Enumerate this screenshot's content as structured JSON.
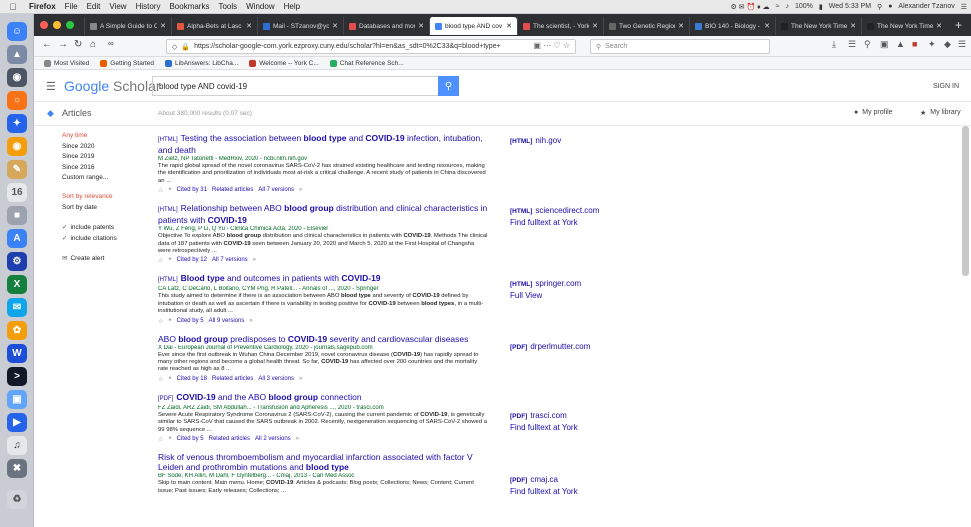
{
  "menubar": {
    "apple": "",
    "items": [
      "Firefox",
      "File",
      "Edit",
      "View",
      "History",
      "Bookmarks",
      "Tools",
      "Window",
      "Help"
    ],
    "battery": "100%",
    "clock": "Wed 5:33 PM",
    "user": "Alexander Tzanov"
  },
  "tabs": [
    {
      "label": "A Simple Guide to C",
      "color": "#888888"
    },
    {
      "label": "Alpha-Bets at Lasc",
      "color": "#e0573b"
    },
    {
      "label": "Mail - STzanov@yo",
      "color": "#2c6fd1"
    },
    {
      "label": "Databases and mor",
      "color": "#e34d4d"
    },
    {
      "label": "blood type AND cov",
      "color": "#4285f4"
    },
    {
      "label": "The scientist, - York",
      "color": "#e34d4d"
    },
    {
      "label": "Two Genetic Region",
      "color": "#444444"
    },
    {
      "label": "BIO 140 - Biology -",
      "color": "#3a7bd5"
    },
    {
      "label": "The New York Time",
      "color": "#222222"
    },
    {
      "label": "The New York Time",
      "color": "#222222"
    }
  ],
  "nav": {
    "url": "https://scholar-google-com.york.ezproxy.cuny.edu/scholar?hl=en&as_sdt=0%2C33&q=blood+type+",
    "search_placeholder": "Search"
  },
  "bookmarks": [
    {
      "label": "Most Visited",
      "color": "#888888"
    },
    {
      "label": "Getting Started",
      "color": "#e66000"
    },
    {
      "label": "LibAnswers: LibCha...",
      "color": "#2c6fd1"
    },
    {
      "label": "Welcome -- York C...",
      "color": "#c0392b"
    },
    {
      "label": "Chat Reference Sch...",
      "color": "#27ae60"
    }
  ],
  "scholar": {
    "logo_google": "Google",
    "logo_scholar": "Scholar",
    "query": "blood type AND covid-19",
    "signin": "SIGN IN",
    "articles_label": "Articles",
    "stats": "About 380,000 results (0.07 sec)",
    "my_profile": "My profile",
    "my_library": "My library"
  },
  "filters": {
    "any_time": "Any time",
    "years": [
      "Since 2020",
      "Since 2019",
      "Since 2016",
      "Custom range..."
    ],
    "sort_relevance": "Sort by relevance",
    "sort_date": "Sort by date",
    "include_patents": "include patents",
    "include_citations": "include citations",
    "create_alert": "Create alert"
  },
  "results": [
    {
      "tag": "[HTML]",
      "title_html": "Testing the association between <b>blood type</b> and <b>COVID-19</b> infection, intubation, and death",
      "authors": "M Zietz, NP Tatonetti - MedRxiv, 2020 - ncbi.nlm.nih.gov",
      "snippet_html": "The rapid global spread of the novel coronavirus SARS-CoV-2 has strained existing healthcare and testing resources, making the identification and prioritization of individuals most at-risk a critical challenge. A recent study of patients in China discovered an ...",
      "cited": "Cited by 31",
      "related": "Related articles",
      "versions": "All 7 versions",
      "side_tag": "[HTML]",
      "side_domain": "nih.gov",
      "side_fulltext": ""
    },
    {
      "tag": "[HTML]",
      "title_html": "Relationship between ABO <b>blood group</b> distribution and clinical characteristics in patients with <b>COVID-19</b>",
      "authors": "Y Wu, Z Feng, P Li, Q Yu - Clinica Chimica Acta, 2020 - Elsevier",
      "snippet_html": "Objective To explore ABO <b>blood group</b> distribution and clinical characteristics in patients with <b>COVID-19</b>. Methods The clinical data of 187 patients with <b>COVID-19</b> seen between January 20, 2020 and March 5, 2020 at the First Hospital of Changsha were retrospectively ...",
      "cited": "Cited by 12",
      "related": "",
      "versions": "All 7 versions",
      "side_tag": "[HTML]",
      "side_domain": "sciencedirect.com",
      "side_fulltext": "Find fulltext at York"
    },
    {
      "tag": "[HTML]",
      "title_html": "<b>Blood type</b> and outcomes in patients with <b>COVID-19</b>",
      "authors": "CA Latz, C DeCarlo, L Boitano, CYM Png, R Patell... - Annals of ..., 2020 - Springer",
      "snippet_html": "This study aimed to determine if there is an association between ABO <b>blood type</b> and severity of <b>COVID-19</b> defined by intubation or death as well as ascertain if there is variability in testing positive for <b>COVID-19</b> between <b>blood types</b>, in a multi-institutional study, all adult ...",
      "cited": "Cited by 5",
      "related": "",
      "versions": "All 9 versions",
      "side_tag": "[HTML]",
      "side_domain": "springer.com",
      "side_fulltext": "Full View"
    },
    {
      "tag": "",
      "title_html": "ABO <b>blood group</b> predisposes to <b>COVID-19</b> severity and cardiovascular diseases",
      "authors": "X Dai - European Journal of Preventive Cardiology, 2020 - journals.sagepub.com",
      "snippet_html": "Ever since the first outbreak in Wuhan China December 2019, novel coronavirus disease (<b>COVID-19</b>) has rapidly spread to many other regions and become a global health threat. So far, <b>COVID-19</b> has affected over 200 countries and the mortality rate reached as high as 8 ...",
      "cited": "Cited by 18",
      "related": "Related articles",
      "versions": "All 3 versions",
      "side_tag": "[PDF]",
      "side_domain": "drperlmutter.com",
      "side_fulltext": ""
    },
    {
      "tag": "[PDF]",
      "title_html": "<b>COVID-19</b> and the ABO <b>blood group</b> connection",
      "authors": "FZ Zaidi, ARZ Zaidi, SM Abdullah... - Transfusion and Apheresis ..., 2020 - trasci.com",
      "snippet_html": "Severe Acute Respiratory Syndrome Coronavirus 2 (SARS-CoV-2), causing the current pandemic of <b>COVID-19</b>, is genetically similar to SARS-CoV that caused the SARS outbreak in 2002. Recently, nextgeneration sequencing of SARS-CoV-2 showed a 99 98% sequence ...",
      "cited": "Cited by 5",
      "related": "Related articles",
      "versions": "All 2 versions",
      "side_tag": "[PDF]",
      "side_domain": "trasci.com",
      "side_fulltext": "Find fulltext at York"
    },
    {
      "tag": "",
      "title_html": "Risk of venous thromboembolism and myocardial infarction associated with factor V Leiden and prothrombin mutations and <b>blood type</b>",
      "authors": "BF Sode, KH Allin, M Dahl, F Gyntelberg... - Cmaj, 2013 - Can Med Assoc",
      "snippet_html": "Skip to main content. Main menu. Home; <b>COVID-19</b>: Articles & podcasts; Blog posts; Collections; News; Content; Current issue; Past issues; Early releases; Collections; ...",
      "cited": "",
      "related": "",
      "versions": "",
      "side_tag": "[PDF]",
      "side_domain": "cmaj.ca",
      "side_fulltext": "Find fulltext at York"
    }
  ]
}
